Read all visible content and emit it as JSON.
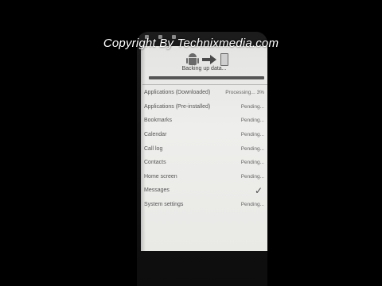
{
  "watermark": "Copyright By Technixmedia.com",
  "header": {
    "status_text": "Backing up data...",
    "progress": 1.0
  },
  "items": [
    {
      "label": "Applications (Downloaded)",
      "status": "Processing... 3%"
    },
    {
      "label": "Applications (Pre-installed)",
      "status": "Pending..."
    },
    {
      "label": "Bookmarks",
      "status": "Pending..."
    },
    {
      "label": "Calendar",
      "status": "Pending..."
    },
    {
      "label": "Call log",
      "status": "Pending..."
    },
    {
      "label": "Contacts",
      "status": "Pending..."
    },
    {
      "label": "Home screen",
      "status": "Pending..."
    },
    {
      "label": "Messages",
      "status": "✓"
    },
    {
      "label": "System settings",
      "status": "Pending..."
    }
  ],
  "icons": {
    "source": "android-icon",
    "direction": "arrow-right-icon",
    "target": "phone-device-icon"
  },
  "colors": {
    "screen_bg": "#eeeeec",
    "text": "#555555",
    "progress": "#555555"
  }
}
